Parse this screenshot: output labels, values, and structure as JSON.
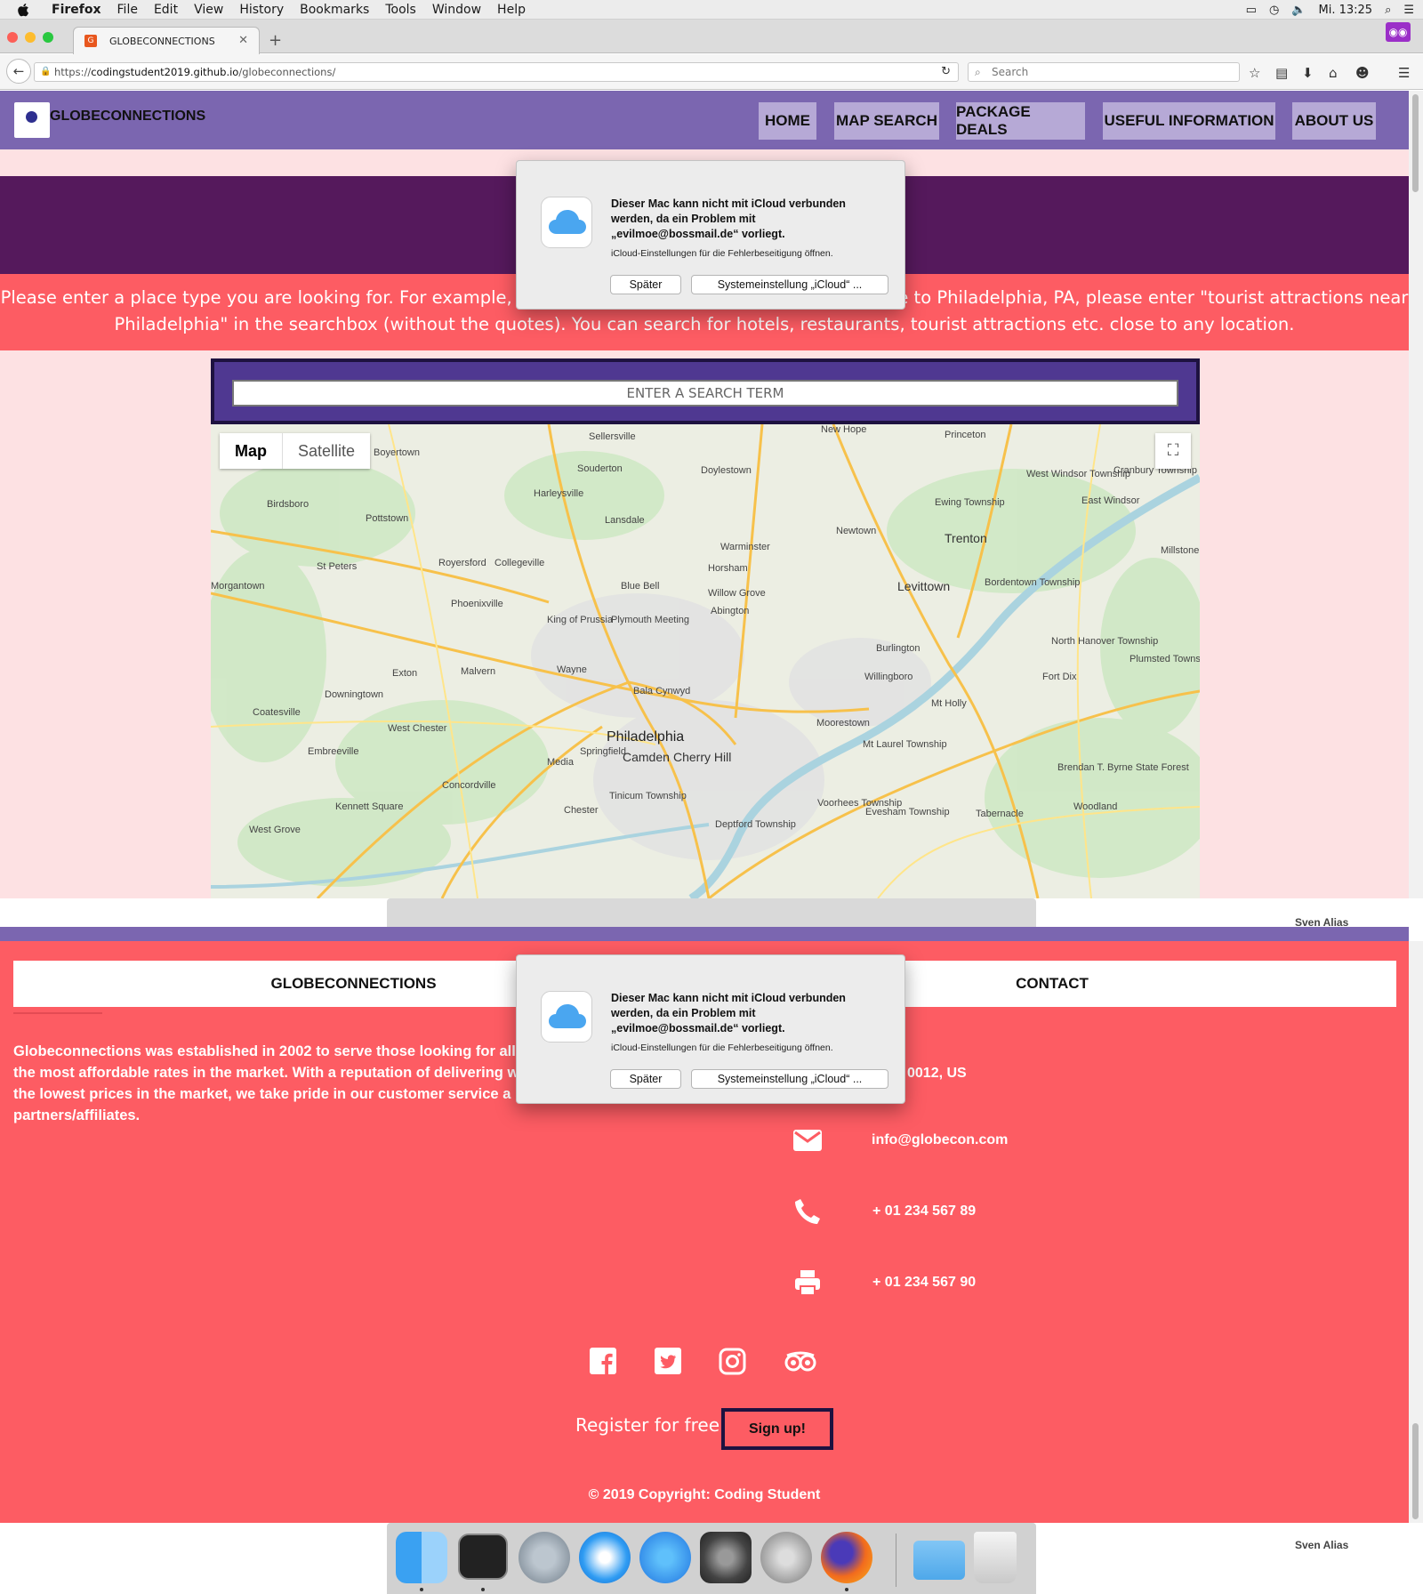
{
  "menubar": {
    "app": "Firefox",
    "items": [
      "File",
      "Edit",
      "View",
      "History",
      "Bookmarks",
      "Tools",
      "Window",
      "Help"
    ],
    "clock": "Mi. 13:25"
  },
  "browser": {
    "tab_title": "GLOBECONNECTIONS",
    "tab_favicon": "G",
    "url_prefix": "https://",
    "url_host": "codingstudent2019.github.io",
    "url_path": "/globeconnections/",
    "search_placeholder": "Search"
  },
  "site": {
    "brand": "GLOBECONNECTIONS",
    "nav": [
      "HOME",
      "MAP SEARCH",
      "PACKAGE DEALS",
      "USEFUL INFORMATION",
      "ABOUT US"
    ],
    "instructions": "Please enter a place type you are looking for. For example, if you are looking for tourist attractions close to Philadelphia, PA, please enter \"tourist attractions near Philadelphia\" in the searchbox (without the quotes). You can search for hotels, restaurants, tourist attractions etc. close to any location.",
    "search_placeholder": "ENTER A SEARCH TERM",
    "map": {
      "type_map": "Map",
      "type_satellite": "Satellite",
      "places": [
        {
          "name": "Philadelphia",
          "size": "big"
        },
        {
          "name": "Trenton",
          "size": "med"
        },
        {
          "name": "Levittown",
          "size": "med"
        },
        {
          "name": "Camden",
          "size": "med"
        },
        {
          "name": "Cherry Hill",
          "size": "med"
        },
        {
          "name": "Princeton",
          "size": "small"
        },
        {
          "name": "New Hope",
          "size": "small"
        },
        {
          "name": "Sellersville",
          "size": "small"
        },
        {
          "name": "Boyertown",
          "size": "small"
        },
        {
          "name": "Souderton",
          "size": "small"
        },
        {
          "name": "Doylestown",
          "size": "small"
        },
        {
          "name": "Harleysville",
          "size": "small"
        },
        {
          "name": "Birdsboro",
          "size": "small"
        },
        {
          "name": "Pottstown",
          "size": "small"
        },
        {
          "name": "Lansdale",
          "size": "small"
        },
        {
          "name": "Newtown",
          "size": "small"
        },
        {
          "name": "Warminster",
          "size": "small"
        },
        {
          "name": "Horsham",
          "size": "small"
        },
        {
          "name": "St Peters",
          "size": "small"
        },
        {
          "name": "Royersford",
          "size": "small"
        },
        {
          "name": "Collegeville",
          "size": "small"
        },
        {
          "name": "Blue Bell",
          "size": "small"
        },
        {
          "name": "Willow Grove",
          "size": "small"
        },
        {
          "name": "Abington",
          "size": "small"
        },
        {
          "name": "Phoenixville",
          "size": "small"
        },
        {
          "name": "King of Prussia",
          "size": "small"
        },
        {
          "name": "Plymouth Meeting",
          "size": "small"
        },
        {
          "name": "Burlington",
          "size": "small"
        },
        {
          "name": "Exton",
          "size": "small"
        },
        {
          "name": "Malvern",
          "size": "small"
        },
        {
          "name": "Wayne",
          "size": "small"
        },
        {
          "name": "Willingboro",
          "size": "small"
        },
        {
          "name": "Downingtown",
          "size": "small"
        },
        {
          "name": "Bala Cynwyd",
          "size": "small"
        },
        {
          "name": "Coatesville",
          "size": "small"
        },
        {
          "name": "West Chester",
          "size": "small"
        },
        {
          "name": "Moorestown",
          "size": "small"
        },
        {
          "name": "Mt Holly",
          "size": "small"
        },
        {
          "name": "Springfield",
          "size": "small"
        },
        {
          "name": "Media",
          "size": "small"
        },
        {
          "name": "Embreeville",
          "size": "small"
        },
        {
          "name": "Concordville",
          "size": "small"
        },
        {
          "name": "Tinicum Township",
          "size": "small"
        },
        {
          "name": "Chester",
          "size": "small"
        },
        {
          "name": "Kennett Square",
          "size": "small"
        },
        {
          "name": "West Grove",
          "size": "small"
        },
        {
          "name": "Deptford Township",
          "size": "small"
        },
        {
          "name": "Voorhees Township",
          "size": "small"
        },
        {
          "name": "Evesham Township",
          "size": "small"
        },
        {
          "name": "Mt Laurel Township",
          "size": "small"
        },
        {
          "name": "Tabernacle",
          "size": "small"
        },
        {
          "name": "Woodland",
          "size": "small"
        },
        {
          "name": "Brendan T. Byrne State Forest",
          "size": "small"
        },
        {
          "name": "Fort Dix",
          "size": "small"
        },
        {
          "name": "Plumsted Township",
          "size": "small"
        },
        {
          "name": "North Hanover Township",
          "size": "small"
        },
        {
          "name": "Bordentown Township",
          "size": "small"
        },
        {
          "name": "Ewing Township",
          "size": "small"
        },
        {
          "name": "West Windsor Township",
          "size": "small"
        },
        {
          "name": "Cranbury Township",
          "size": "small"
        },
        {
          "name": "East Windsor",
          "size": "small"
        },
        {
          "name": "Millstone",
          "size": "small"
        },
        {
          "name": "Morgantown",
          "size": "small"
        }
      ]
    },
    "footer": {
      "title_left": "GLOBECONNECTIONS",
      "title_right": "CONTACT",
      "about": "Globeconnections was established in 2002 to serve those looking for all ki the most affordable rates in the market. With a reputation of delivering w of the lowest prices in the market, we take pride in our customer service a partners/affiliates.",
      "address_partial": "0012, US",
      "email": "info@globecon.com",
      "phone": "+ 01 234 567 89",
      "fax": "+ 01 234 567 90",
      "register_text": "Register for free",
      "signup_label": "Sign up!",
      "copyright": "© 2019 Copyright: Coding Student"
    }
  },
  "dialog": {
    "message": "Dieser Mac kann nicht mit iCloud verbunden werden, da ein Problem mit „evilmoe@bossmail.de“ vorliegt.",
    "submessage": "iCloud-Einstellungen für die Fehlerbeseitigung öffnen.",
    "later": "Später",
    "settings": "Systemeinstellung „iCloud“ ..."
  },
  "desktop": {
    "alias_label": "Sven Alias"
  },
  "colors": {
    "header_purple": "#7b66b0",
    "nav_button": "#b6a9d6",
    "dark_purple": "#55195c",
    "coral": "#fd5c63",
    "search_panel": "#4f3891"
  }
}
